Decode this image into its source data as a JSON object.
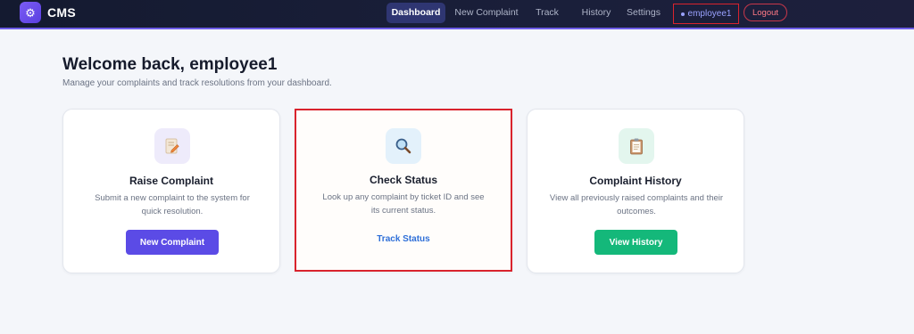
{
  "app": {
    "name": "CMS",
    "logo_icon": "gear-icon"
  },
  "nav": {
    "links": [
      {
        "label": "Dashboard",
        "active": true
      },
      {
        "label": "New Complaint",
        "active": false
      },
      {
        "label": "Track",
        "active": false
      },
      {
        "label": "History",
        "active": false
      },
      {
        "label": "Settings",
        "active": false
      }
    ],
    "user": "employee1",
    "logout_label": "Logout"
  },
  "header": {
    "title": "Welcome back, employee1",
    "subtitle": "Manage your complaints and track resolutions from your dashboard."
  },
  "cards": [
    {
      "icon": "pencil-paper-icon",
      "title": "Raise Complaint",
      "description": "Submit a new complaint to the system for quick resolution.",
      "action_label": "New Complaint",
      "action_color": "#5b4be6"
    },
    {
      "icon": "magnifier-icon",
      "title": "Check Status",
      "description": "Look up any complaint by ticket ID and see its current status.",
      "action_label": "Track Status",
      "action_color": "#2f6fd8"
    },
    {
      "icon": "clipboard-icon",
      "title": "Complaint History",
      "description": "View all previously raised complaints and their outcomes.",
      "action_label": "View History",
      "action_color": "#14b87a"
    }
  ],
  "colors": {
    "nav_bg": "#161b33",
    "accent": "#5b4be6",
    "highlight_border": "#d9232d",
    "success": "#14b87a"
  }
}
